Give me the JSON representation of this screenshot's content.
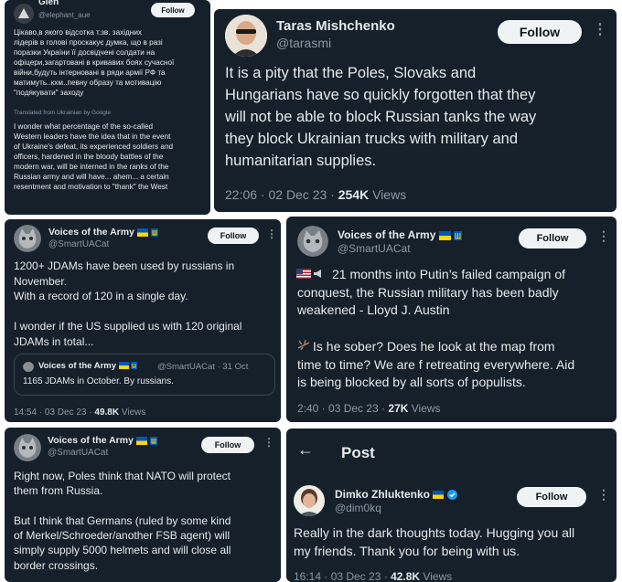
{
  "c1": {
    "name": "Gleh",
    "handle": "@elephant_aue",
    "follow": "Follow",
    "original_text": "Цікаво,в якого відсотка т.зв. західних\nлідерів в голові проскакує думка, що в разі\nпоразки України її досвідчені солдати на\nофіцери,загартовані в кривавих боях сучасної\nвійни,будуть інтерновані в ряди армії РФ та\nматимуть..кхм..певну образу та мотивацію\n\"подякувати\" заходу",
    "translated_label": "Translated from Ukrainian by Google",
    "translated_text": "I wonder what percentage of the so-called\nWestern leaders have the idea that in the event\nof Ukraine's defeat, its experienced soldiers and\nofficers, hardened in the bloody battles of the\nmodern war, will be interned in the ranks of the\nRussian army and will have... ahem... a certain\nresentment and motivation to \"thank\" the West"
  },
  "c2": {
    "name": "Taras Mishchenko",
    "handle": "@tarasmi",
    "follow": "Follow",
    "more": "⋮",
    "text": "It is a pity that the Poles, Slovaks and\nHungarians have so quickly forgotten that they\nwill not be able to block Russian tanks the way\nthey block Ukrainian trucks with military and\nhumanitarian supplies.",
    "time": "22:06 · 02 Dec 23 · ",
    "views_count": "254K",
    "views_label": " Views"
  },
  "c3": {
    "name": "Voices of the Army",
    "handle": "@SmartUACat",
    "follow": "Follow",
    "more": "⋮",
    "text": "1200+ JDAMs have been used by russians in\nNovember.\nWith a record of 120 in a single day.\n\nI wonder if the US supplied us with 120 original\nJDAMs in total...",
    "quote_name": "Voices of the Army",
    "quote_meta": "@SmartUACat · 31 Oct",
    "quote_text": "1165 JDAMs in October. By russians.",
    "time": "14:54 · 03 Dec 23 · ",
    "views_count": "49.8K",
    "views_label": " Views"
  },
  "c4": {
    "name": "Voices of the Army",
    "handle": "@SmartUACat",
    "follow": "Follow",
    "more": "⋮",
    "line1": "21 months into Putin’s failed campaign of\nconquest, the Russian military has been badly\nweakened - Lloyd J. Austin",
    "line2": "Is he sober? Does he look at the map from\ntime to time? We are f retreating everywhere. Aid\nis being blocked by all sorts of populists.",
    "time": "2:40 · 03 Dec 23 · ",
    "views_count": "27K",
    "views_label": " Views"
  },
  "c5": {
    "name": "Voices of the Army",
    "handle": "@SmartUACat",
    "follow": "Follow",
    "more": "⋮",
    "text": "Right now, Poles think that NATO will protect\nthem from Russia.\n\nBut I think that Germans (ruled by some kind\nof Merkel/Schroeder/another FSB agent) will\nsimply supply 5000 helmets and will close all\nborder crossings."
  },
  "c6": {
    "back": "←",
    "header": "Post",
    "name": "Dimko Zhluktenko",
    "handle": "@dim0kq",
    "follow": "Follow",
    "more": "⋮",
    "text": "Really in the dark thoughts today. Hugging you all\nmy friends. Thank you for being with us.",
    "time": "16:14 · 03 Dec 23 · ",
    "views_count": "42.8K",
    "views_label": " Views"
  },
  "colors": {
    "bg": "#15202b",
    "accent": "#1d9bf0",
    "verified": "#1d9bf0"
  }
}
